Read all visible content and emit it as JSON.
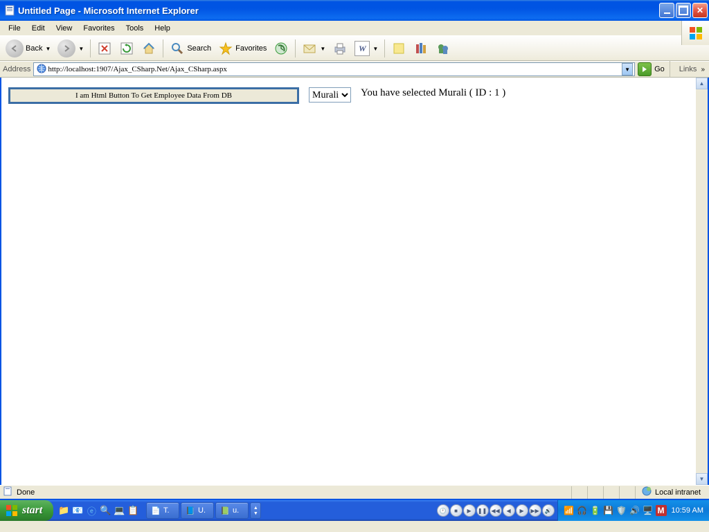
{
  "titlebar": {
    "title": "Untitled Page - Microsoft Internet Explorer"
  },
  "menu": {
    "file": "File",
    "edit": "Edit",
    "view": "View",
    "favorites": "Favorites",
    "tools": "Tools",
    "help": "Help"
  },
  "toolbar": {
    "back": "Back",
    "search": "Search",
    "favorites": "Favorites"
  },
  "addressbar": {
    "label": "Address",
    "url": "http://localhost:1907/Ajax_CSharp.Net/Ajax_CSharp.aspx",
    "go": "Go",
    "links": "Links"
  },
  "page": {
    "button_label": "I am Html Button To Get Employee Data From DB",
    "select_value": "Murali",
    "result_text": "You have selected Murali ( ID : 1 )"
  },
  "statusbar": {
    "status": "Done",
    "zone": "Local intranet"
  },
  "taskbar": {
    "start": "start",
    "tasks": [
      {
        "label": "T."
      },
      {
        "label": "U."
      },
      {
        "label": "u."
      }
    ],
    "clock": "10:59 AM"
  }
}
